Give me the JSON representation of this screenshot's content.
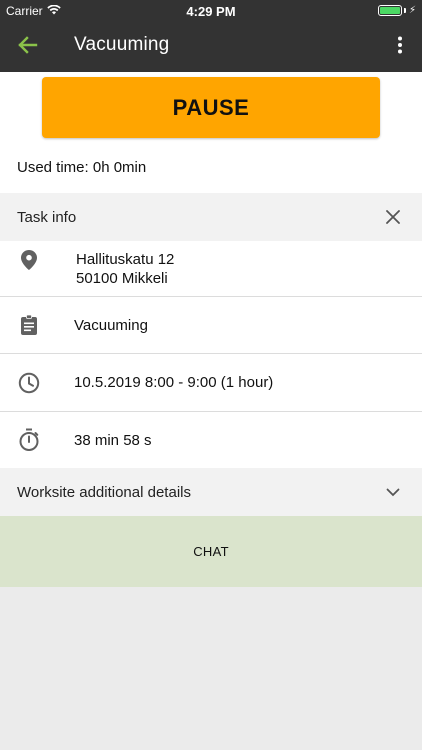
{
  "status_bar": {
    "carrier": "Carrier",
    "time": "4:29 PM"
  },
  "nav": {
    "title": "Vacuuming",
    "back_icon": "arrow-left-icon",
    "menu_icon": "more-vertical-icon"
  },
  "pause_button": {
    "label": "PAUSE"
  },
  "used_time": "Used time: 0h 0min",
  "task_info": {
    "header": "Task info",
    "address_line1": "Hallituskatu 12",
    "address_line2": "50100 Mikkeli",
    "task_name": "Vacuuming",
    "schedule": "10.5.2019 8:00 - 9:00 (1 hour)",
    "duration": "38 min 58 s"
  },
  "worksite": {
    "header": "Worksite additional details"
  },
  "chat_button": {
    "label": "CHAT"
  },
  "colors": {
    "nav_bg": "#333333",
    "accent_green": "#8bc34a",
    "pause_orange": "#ffa500",
    "chat_bg": "#dae4cc",
    "page_bg": "#ebebeb"
  }
}
